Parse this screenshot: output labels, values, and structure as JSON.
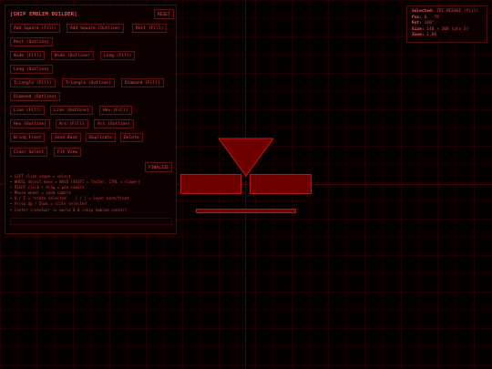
{
  "builder": {
    "title": "[SHIP EMBLEM BUILDER]",
    "reset_label": "RESET",
    "finalize_label": "FINALIZE",
    "buttons": [
      "Add Square (Fill)",
      "Add Square (Outline)",
      "Rect (Fill)",
      "Rect (Outline)",
      "Wide (Fill)",
      "Wide (Outline)",
      "Long (Fill)",
      "Long (Outline)",
      "Triangle (Fill)",
      "Triangle (Outline)",
      "Diamond (Fill)",
      "Diamond (Outline)",
      "Line (Fill)",
      "Line (Outline)",
      "Hex (Fill)",
      "Hex (Outline)",
      "Arc (Fill)",
      "Arc (Outline)",
      "Bring Front",
      "Send Back",
      "Duplicate",
      "Delete",
      "Clear Select",
      "Fit View"
    ],
    "help": [
      "• LEFT click shape = select",
      "• WHEEL object move = WASD (SHIFT = faster, CTRL = slower)",
      "• RIGHT click + drag = pan camera",
      "• Mouse wheel = zoom camera",
      "• Q / E = rotate selected    [ / ] = layer back/front",
      "• Arrow Up / Down = scale selected",
      "• Center crosshair is world 0,0 (ship emblem center)"
    ]
  },
  "info": {
    "selected_key": "Selected:",
    "selected_val": "TRI-DEE0SE (fill)",
    "pos_key": "Pos:",
    "pos_val": "0, -79",
    "rot_key": "Rot:",
    "rot_val": "180°",
    "size_key": "Size:",
    "size_val": "140 × 100 (pts 3)",
    "zoom_key": "Zoom:",
    "zoom_val": "1.00"
  },
  "colors": {
    "accent": "#e05050",
    "shape_fill": "#6e0000",
    "shape_stroke": "#b01818",
    "background": "#050000"
  }
}
